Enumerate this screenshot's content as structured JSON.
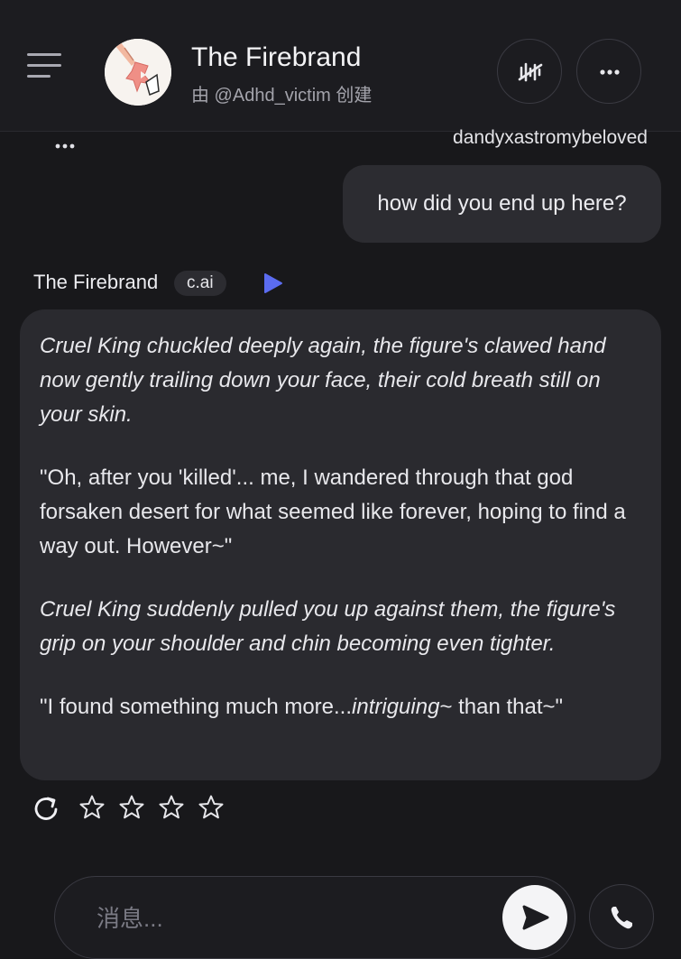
{
  "header": {
    "title": "The Firebrand",
    "creator": "由 @Adhd_victim 创建"
  },
  "chat": {
    "user_name": "dandyxastromybeloved",
    "user_message": "how did you end up here?",
    "bot_name": "The Firebrand",
    "bot_badge": "c.ai",
    "bot_message": {
      "p1": "Cruel King chuckled deeply again, the figure's clawed hand now gently trailing down your face, their cold breath still on your skin.",
      "p2": "\"Oh, after you 'killed'... me, I wandered through that god forsaken desert for what seemed like forever, hoping to find a way out. However~\"",
      "p3": "Cruel King suddenly pulled you up against them, the figure's grip on your shoulder and chin becoming even tighter.",
      "p4_before": "\"I found something much more...",
      "p4_italic": "intriguing",
      "p4_after": "~ than that~\""
    },
    "rating": {
      "stars_total": 4,
      "stars_filled": 0
    }
  },
  "composer": {
    "placeholder": "消息..."
  },
  "colors": {
    "background": "#18181b",
    "header": "#1c1c20",
    "bubble": "#2a2a2f",
    "accent_play": "#5b6cf0"
  }
}
